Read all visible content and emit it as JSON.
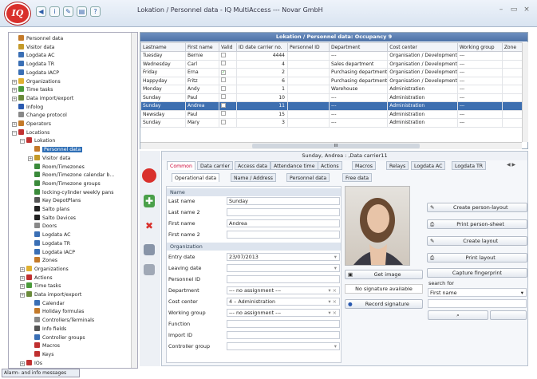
{
  "window": {
    "title": "Lokation / Personnel data - IQ MultiAccess --- Novar GmbH",
    "logo": "IQ",
    "controls": [
      "–",
      "▭",
      "×"
    ]
  },
  "tree": {
    "items": [
      {
        "label": "Personnel data",
        "indent": 0,
        "color": "#c47a2a"
      },
      {
        "label": "Visitor data",
        "indent": 0,
        "color": "#c49a2a"
      },
      {
        "label": "Logdata AC",
        "indent": 0,
        "color": "#3a6fb5"
      },
      {
        "label": "Logdata TR",
        "indent": 0,
        "color": "#3a6fb5"
      },
      {
        "label": "Logdata IACP",
        "indent": 0,
        "color": "#3a6fb5"
      },
      {
        "label": "Organizations",
        "indent": 0,
        "color": "#e0b030",
        "pm": "+"
      },
      {
        "label": "Time tasks",
        "indent": 0,
        "color": "#4a9a3a",
        "pm": "+"
      },
      {
        "label": "Data import/export",
        "indent": 0,
        "color": "#6a8a3a",
        "pm": "+"
      },
      {
        "label": "Infolog",
        "indent": 0,
        "color": "#2a5ab0"
      },
      {
        "label": "Change protocol",
        "indent": 0,
        "color": "#888888"
      },
      {
        "label": "Operators",
        "indent": 0,
        "color": "#c47a2a",
        "pm": "+"
      },
      {
        "label": "Locations",
        "indent": 0,
        "color": "#c03030",
        "pm": "−"
      },
      {
        "label": "Lokation",
        "indent": 1,
        "color": "#c03030",
        "pm": "−"
      },
      {
        "label": "Personnel data",
        "indent": 2,
        "color": "#c47a2a",
        "sel": true
      },
      {
        "label": "Visitor data",
        "indent": 2,
        "color": "#c49a2a",
        "pm": "+"
      },
      {
        "label": "Room/Timezones",
        "indent": 2,
        "color": "#3a8a3a"
      },
      {
        "label": "Room/Timezone calendar b...",
        "indent": 2,
        "color": "#3a8a3a"
      },
      {
        "label": "Room/Timezone groups",
        "indent": 2,
        "color": "#3a8a3a"
      },
      {
        "label": "locking-cylinder weekly pans",
        "indent": 2,
        "color": "#3a8a3a"
      },
      {
        "label": "Key DepotPlans",
        "indent": 2,
        "color": "#555555"
      },
      {
        "label": "Salto plans",
        "indent": 2,
        "color": "#222222"
      },
      {
        "label": "Salto Devices",
        "indent": 2,
        "color": "#222222"
      },
      {
        "label": "Doors",
        "indent": 2,
        "color": "#888888"
      },
      {
        "label": "Logdata AC",
        "indent": 2,
        "color": "#3a6fb5"
      },
      {
        "label": "Logdata TR",
        "indent": 2,
        "color": "#3a6fb5"
      },
      {
        "label": "Logdata IACP",
        "indent": 2,
        "color": "#3a6fb5"
      },
      {
        "label": "Zones",
        "indent": 2,
        "color": "#c47a2a"
      },
      {
        "label": "Organizations",
        "indent": 1,
        "color": "#e0b030",
        "pm": "+"
      },
      {
        "label": "Actions",
        "indent": 1,
        "color": "#c03030",
        "pm": "+"
      },
      {
        "label": "Time tasks",
        "indent": 1,
        "color": "#4a9a3a",
        "pm": "+"
      },
      {
        "label": "Data import/export",
        "indent": 1,
        "color": "#6a8a3a",
        "pm": "+"
      },
      {
        "label": "Calendar",
        "indent": 2,
        "color": "#3a6fb5"
      },
      {
        "label": "Holiday formulas",
        "indent": 2,
        "color": "#c47a2a"
      },
      {
        "label": "Controllers/Terminals",
        "indent": 2,
        "color": "#888888"
      },
      {
        "label": "Info fields",
        "indent": 2,
        "color": "#555555"
      },
      {
        "label": "Controller groups",
        "indent": 2,
        "color": "#3a6fb5"
      },
      {
        "label": "Macros",
        "indent": 2,
        "color": "#c03030"
      },
      {
        "label": "Keys",
        "indent": 2,
        "color": "#c03030"
      },
      {
        "label": "IOs",
        "indent": 1,
        "color": "#c03030",
        "pm": "+"
      }
    ]
  },
  "status": {
    "label": "Alarm- and info messages"
  },
  "grid": {
    "title": "Lokation / Personnel data: Occupancy 9",
    "columns": [
      "Lastname",
      "First name",
      "Valid",
      "ID date carrier no.",
      "Personnel ID",
      "Department",
      "Cost center",
      "Working group",
      "Zone"
    ],
    "rows": [
      [
        "Tuesday",
        "Bernie",
        "",
        "4444",
        "",
        "---",
        "Organisation / Development",
        "---",
        ""
      ],
      [
        "Wednesday",
        "Carl",
        "",
        "4",
        "",
        "Sales department",
        "Organisation / Development",
        "---",
        ""
      ],
      [
        "Friday",
        "Erna",
        "✓",
        "2",
        "",
        "Purchasing department",
        "Organisation / Development",
        "---",
        ""
      ],
      [
        "Happyday",
        "Fritz",
        "",
        "6",
        "",
        "Purchasing department",
        "Organisation / Development",
        "---",
        ""
      ],
      [
        "Monday",
        "Andy",
        "",
        "1",
        "",
        "Warehouse",
        "Administration",
        "---",
        ""
      ],
      [
        "Sunday",
        "Paul",
        "",
        "10",
        "",
        "---",
        "Administration",
        "---",
        ""
      ],
      [
        "Sunday",
        "Andrea",
        "",
        "11",
        "",
        "---",
        "Administration",
        "---",
        ""
      ],
      [
        "Newsday",
        "Paul",
        "",
        "15",
        "",
        "---",
        "Administration",
        "---",
        ""
      ],
      [
        "Sunday",
        "Mary",
        "",
        "3",
        "",
        "---",
        "Administration",
        "---",
        ""
      ]
    ],
    "selected_row": 6,
    "scroll_label": "III"
  },
  "detail": {
    "header": "Sunday, Andrea :  ,Data carrier11",
    "tabs": [
      "Common",
      "Data carrier",
      "Access data",
      "Attendance time",
      "Actions",
      "Macros",
      "Relays",
      "Logdata AC",
      "Logdata TR"
    ],
    "subtabs": [
      "Operational data",
      "Name / Address",
      "Personnel data",
      "Free data"
    ],
    "sections": {
      "name": "Name",
      "org": "Organization"
    },
    "fields": {
      "last_name_l": "Last name",
      "last_name": "Sunday",
      "last_name2_l": "Last name 2",
      "last_name2": "",
      "first_name_l": "First name",
      "first_name": "Andrea",
      "first_name2_l": "First name 2",
      "first_name2": "",
      "entry_l": "Entry date",
      "entry": "23/07/2013",
      "leaving_l": "Leaving date",
      "leaving": "",
      "pid_l": "Personnel ID",
      "pid": "",
      "dept_l": "Department",
      "dept": "--- no assignment ---",
      "cost_l": "Cost center",
      "cost": "4 – Administration",
      "wg_l": "Working group",
      "wg": "--- no assignment ---",
      "func_l": "Function",
      "func": "",
      "import_l": "Import ID",
      "import": "",
      "cg_l": "Controller group",
      "cg": ""
    }
  },
  "photo": {
    "get_image": "Get image",
    "no_signature": "No signature available",
    "record_signature": "Record signature"
  },
  "actions": {
    "create_person_layout": "Create person-layout",
    "print_person_sheet": "Print person-sheet",
    "create_layout": "Create layout",
    "print_layout": "Print layout",
    "capture_fingerprint": "Capture fingerprint",
    "search_for": "search for",
    "search_field": "First name",
    "search_btn": "⌕"
  },
  "colors": {
    "selection": "#3e6fb0",
    "header": "#4c71a6",
    "accent_red": "#d9302c"
  }
}
